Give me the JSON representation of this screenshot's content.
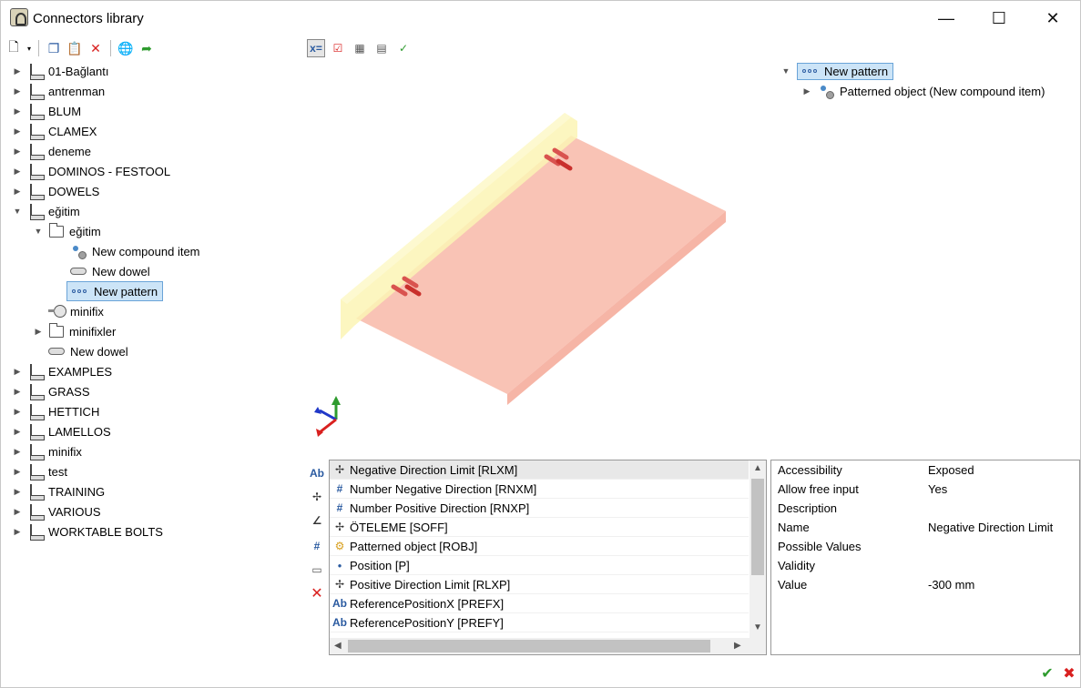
{
  "window": {
    "title": "Connectors library"
  },
  "library_tree": [
    {
      "label": "01-Bağlantı",
      "type": "library",
      "expanded": false
    },
    {
      "label": "antrenman",
      "type": "library",
      "expanded": false
    },
    {
      "label": "BLUM",
      "type": "library",
      "expanded": false
    },
    {
      "label": "CLAMEX",
      "type": "library",
      "expanded": false
    },
    {
      "label": "deneme",
      "type": "library",
      "expanded": false
    },
    {
      "label": "DOMINOS - FESTOOL",
      "type": "library",
      "expanded": false
    },
    {
      "label": "DOWELS",
      "type": "library",
      "expanded": false
    },
    {
      "label": "eğitim",
      "type": "library",
      "expanded": true
    },
    {
      "label": "eğitim",
      "type": "folder",
      "expanded": true,
      "level": 1
    },
    {
      "label": "New compound item",
      "type": "compound",
      "level": 2
    },
    {
      "label": "New dowel",
      "type": "dowel",
      "level": 2
    },
    {
      "label": "New pattern",
      "type": "pattern",
      "level": 2,
      "selected": true
    },
    {
      "label": "minifix",
      "type": "minifix",
      "level": 1
    },
    {
      "label": "minifixler",
      "type": "folder",
      "expanded": false,
      "level": 1
    },
    {
      "label": "New dowel",
      "type": "dowel",
      "level": 1
    },
    {
      "label": "EXAMPLES",
      "type": "library",
      "expanded": false
    },
    {
      "label": "GRASS",
      "type": "library",
      "expanded": false
    },
    {
      "label": "HETTICH",
      "type": "library",
      "expanded": false
    },
    {
      "label": "LAMELLOS",
      "type": "library",
      "expanded": false
    },
    {
      "label": "minifix",
      "type": "library",
      "expanded": false
    },
    {
      "label": "test",
      "type": "library",
      "expanded": false
    },
    {
      "label": "TRAINING",
      "type": "library",
      "expanded": false
    },
    {
      "label": "VARIOUS",
      "type": "library",
      "expanded": false
    },
    {
      "label": "WORKTABLE BOLTS",
      "type": "library",
      "expanded": false
    }
  ],
  "pattern_tree": {
    "root": "New pattern",
    "child": "Patterned object (New compound item)"
  },
  "property_list": [
    {
      "icon": "limit-icon",
      "label": "Negative Direction Limit [RLXM]",
      "selected": true
    },
    {
      "icon": "number-icon",
      "label": "Number Negative Direction [RNXM]"
    },
    {
      "icon": "number-icon",
      "label": "Number Positive Direction  [RNXP]"
    },
    {
      "icon": "limit-icon",
      "label": "ÖTELEME [SOFF]"
    },
    {
      "icon": "object-icon",
      "label": "Patterned object [ROBJ]"
    },
    {
      "icon": "point-icon",
      "label": "Position [P]"
    },
    {
      "icon": "limit-icon",
      "label": "Positive Direction Limit [RLXP]"
    },
    {
      "icon": "text-icon",
      "label": "ReferencePositionX [PREFX]"
    },
    {
      "icon": "text-icon",
      "label": "ReferencePositionY [PREFY]"
    }
  ],
  "details": [
    {
      "key": "Accessibility",
      "value": "Exposed"
    },
    {
      "key": "Allow free input",
      "value": "Yes"
    },
    {
      "key": "Description",
      "value": ""
    },
    {
      "key": "Name",
      "value": "Negative Direction Limit"
    },
    {
      "key": "Possible Values",
      "value": ""
    },
    {
      "key": "Validity",
      "value": ""
    },
    {
      "key": "Value",
      "value": "-300 mm"
    }
  ],
  "colors": {
    "selection_bg": "#cce4f7",
    "selection_border": "#6aa4d8",
    "panel_body": "#f8b9a8",
    "panel_edge": "#fbf5b5",
    "dowel": "#d9534f",
    "ok": "#2e9b2e",
    "cancel": "#d9201f"
  }
}
